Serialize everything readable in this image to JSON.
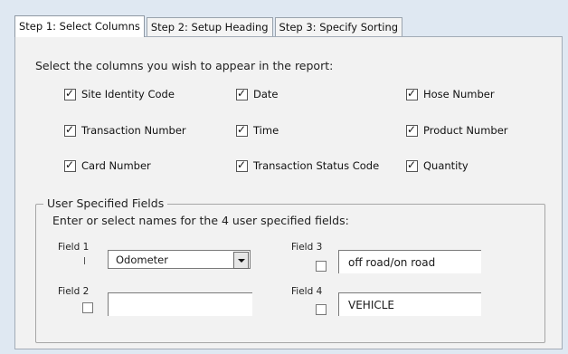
{
  "tabs": [
    {
      "label": "Step 1: Select Columns",
      "active": true
    },
    {
      "label": "Step 2: Setup Heading",
      "active": false
    },
    {
      "label": "Step 3: Specify Sorting",
      "active": false
    }
  ],
  "instruction": "Select the columns you wish to appear in the report:",
  "columns": [
    {
      "label": "Site Identity Code",
      "checked": true
    },
    {
      "label": "Date",
      "checked": true
    },
    {
      "label": "Hose Number",
      "checked": true
    },
    {
      "label": "Transaction Number",
      "checked": true
    },
    {
      "label": "Time",
      "checked": true
    },
    {
      "label": "Product Number",
      "checked": true
    },
    {
      "label": "Card Number",
      "checked": true
    },
    {
      "label": "Transaction Status Code",
      "checked": true
    },
    {
      "label": "Quantity",
      "checked": true
    }
  ],
  "user_fields": {
    "legend": "User Specified Fields",
    "instruction": "Enter or select names for the 4 user specified fields:",
    "field1": {
      "label": "Field 1",
      "value": "Odometer"
    },
    "field2": {
      "label": "Field 2",
      "value": ""
    },
    "field3": {
      "label": "Field 3",
      "value": "off road/on road"
    },
    "field4": {
      "label": "Field 4",
      "value": "VEHICLE"
    }
  }
}
